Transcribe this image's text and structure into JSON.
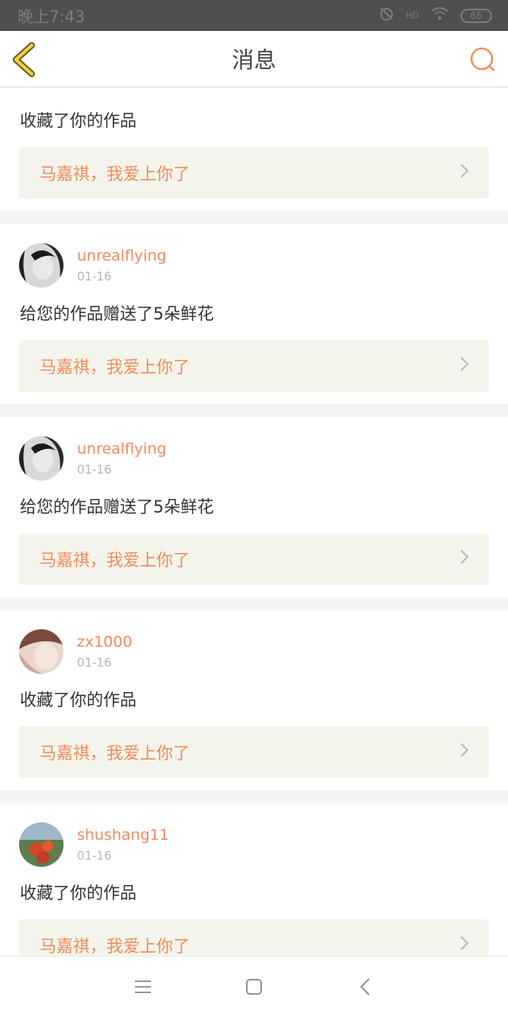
{
  "status_bar": {
    "time": "晚上7:43",
    "battery": "66",
    "network": "HD"
  },
  "header": {
    "title": "消息"
  },
  "colors": {
    "accent": "#f08a5d",
    "work_bg": "#f5f4ec",
    "status_bg": "#4f4f4f"
  },
  "messages": [
    {
      "action": "收藏了你的作品",
      "work": "马嘉祺，我爱上你了"
    },
    {
      "username": "unrealflying",
      "date": "01-16",
      "action": "给您的作品赠送了5朵鲜花",
      "work": "马嘉祺，我爱上你了"
    },
    {
      "username": "unrealflying",
      "date": "01-16",
      "action": "给您的作品赠送了5朵鲜花",
      "work": "马嘉祺，我爱上你了"
    },
    {
      "username": "zx1000",
      "date": "01-16",
      "action": "收藏了你的作品",
      "work": "马嘉祺，我爱上你了"
    },
    {
      "username": "shushang11",
      "date": "01-16",
      "action": "收藏了你的作品",
      "work": "马嘉祺，我爱上你了"
    }
  ],
  "icons": {
    "back": "chevron-left-icon",
    "search": "search-icon",
    "menu": "menu-icon",
    "home": "home-icon",
    "nav_back": "back-icon"
  }
}
